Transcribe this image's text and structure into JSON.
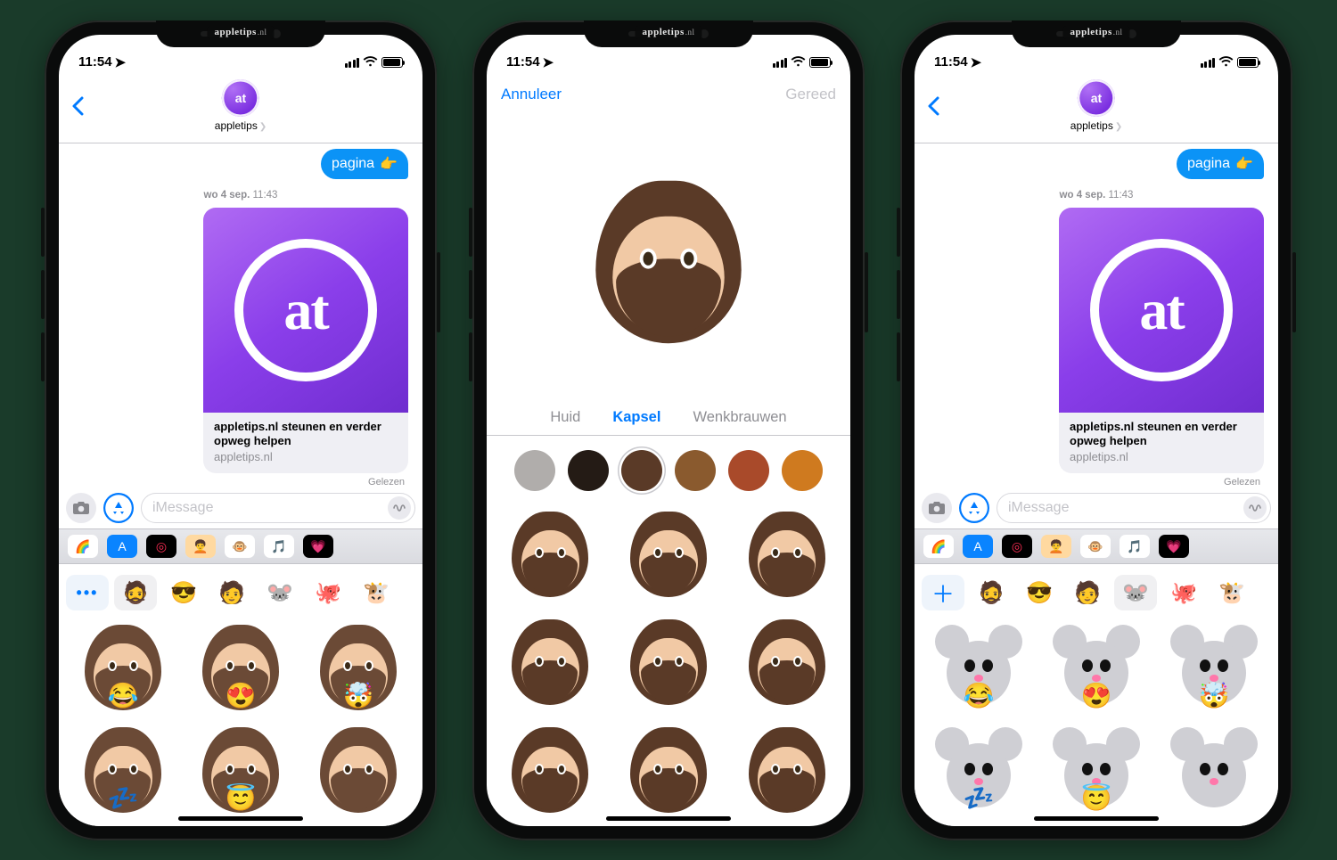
{
  "watermark": {
    "brand": "appletips",
    "tld": ".nl"
  },
  "status": {
    "time": "11:54",
    "location_indicator": "➤"
  },
  "messages": {
    "contact_name": "appletips",
    "bubble_text": "pagina",
    "bubble_emoji": "👉",
    "timestamp_day": "wo 4 sep.",
    "timestamp_time": "11:43",
    "link_title": "appletips.nl steunen en verder opweg helpen",
    "link_domain": "appletips.nl",
    "read_receipt": "Gelezen",
    "input_placeholder": "iMessage",
    "at_logo_text": "at"
  },
  "app_strip": [
    {
      "name": "photos-app",
      "bg": "#fff",
      "glyph": "🌈",
      "extra": ""
    },
    {
      "name": "app-store",
      "bg": "#0a84ff",
      "glyph": "A",
      "extra": ""
    },
    {
      "name": "activity-app",
      "bg": "#000",
      "glyph": "◎",
      "extra": "color:#ff2d55"
    },
    {
      "name": "memoji-app",
      "bg": "#ffd9a0",
      "glyph": "🧑‍🦱",
      "extra": ""
    },
    {
      "name": "animoji-app",
      "bg": "#fff",
      "glyph": "🐵",
      "extra": ""
    },
    {
      "name": "music-app",
      "bg": "#fff",
      "glyph": "🎵",
      "extra": "color:#ff2d55"
    },
    {
      "name": "hearts-app",
      "bg": "#000",
      "glyph": "💗",
      "extra": ""
    }
  ],
  "memoji_tabs_left": [
    {
      "kind": "more",
      "glyph": "•••",
      "name": "more-button"
    },
    {
      "kind": "memoji",
      "glyph": "🧔",
      "name": "tab-memoji-1",
      "sel": true,
      "tone": "#6b4a36"
    },
    {
      "kind": "memoji",
      "glyph": "😎",
      "name": "tab-memoji-2",
      "tone": "#f3cfa1"
    },
    {
      "kind": "memoji",
      "glyph": "🧑",
      "name": "tab-memoji-3",
      "tone": "#5a3b2e"
    },
    {
      "kind": "animoji",
      "glyph": "🐭",
      "name": "tab-mouse"
    },
    {
      "kind": "animoji",
      "glyph": "🐙",
      "name": "tab-octopus"
    },
    {
      "kind": "animoji",
      "glyph": "🐮",
      "name": "tab-cow"
    }
  ],
  "memoji_tabs_right": [
    {
      "kind": "plus",
      "glyph": "＋",
      "name": "add-memoji-button"
    },
    {
      "kind": "memoji",
      "glyph": "🧔",
      "name": "tab-memoji-1",
      "tone": "#6b4a36"
    },
    {
      "kind": "memoji",
      "glyph": "😎",
      "name": "tab-memoji-2",
      "tone": "#f3cfa1"
    },
    {
      "kind": "memoji",
      "glyph": "🧑",
      "name": "tab-memoji-3",
      "tone": "#5a3b2e"
    },
    {
      "kind": "animoji",
      "glyph": "🐭",
      "name": "tab-mouse",
      "sel": true
    },
    {
      "kind": "animoji",
      "glyph": "🐙",
      "name": "tab-octopus"
    },
    {
      "kind": "animoji",
      "glyph": "🐮",
      "name": "tab-cow"
    }
  ],
  "stickers_memoji": [
    {
      "name": "memoji-laugh-cry",
      "overlay": "😂"
    },
    {
      "name": "memoji-heart-eyes",
      "overlay": "😍"
    },
    {
      "name": "memoji-mind-blown",
      "overlay": "🤯"
    },
    {
      "name": "memoji-sleep",
      "overlay": "💤"
    },
    {
      "name": "memoji-halo",
      "overlay": "😇"
    },
    {
      "name": "memoji-neutral",
      "overlay": ""
    }
  ],
  "stickers_mouse": [
    {
      "name": "mouse-laugh-cry",
      "overlay": "😂"
    },
    {
      "name": "mouse-heart-eyes",
      "overlay": "😍"
    },
    {
      "name": "mouse-mind-blown",
      "overlay": "🤯"
    },
    {
      "name": "mouse-sleep",
      "overlay": "💤"
    },
    {
      "name": "mouse-halo",
      "overlay": "😇"
    },
    {
      "name": "mouse-neutral",
      "overlay": ""
    }
  ],
  "editor": {
    "cancel": "Annuleer",
    "done": "Gereed",
    "tabs": [
      "Huid",
      "Kapsel",
      "Wenkbrauwen"
    ],
    "active_tab": "Kapsel",
    "colors": [
      {
        "name": "gray",
        "hex": "#b0adab"
      },
      {
        "name": "black",
        "hex": "#241b15"
      },
      {
        "name": "dark-brown",
        "hex": "#5a3a27",
        "selected": true
      },
      {
        "name": "brown",
        "hex": "#8a5a2e"
      },
      {
        "name": "chestnut",
        "hex": "#a94a2a"
      },
      {
        "name": "ginger",
        "hex": "#cf7a1f"
      }
    ],
    "hair_styles": [
      "hair-long-center",
      "hair-long-wavy",
      "hair-long-tied",
      "hair-long-side",
      "hair-long-shaggy",
      "hair-dreadlocks",
      "hair-short-1",
      "hair-short-2",
      "hair-short-3"
    ]
  }
}
